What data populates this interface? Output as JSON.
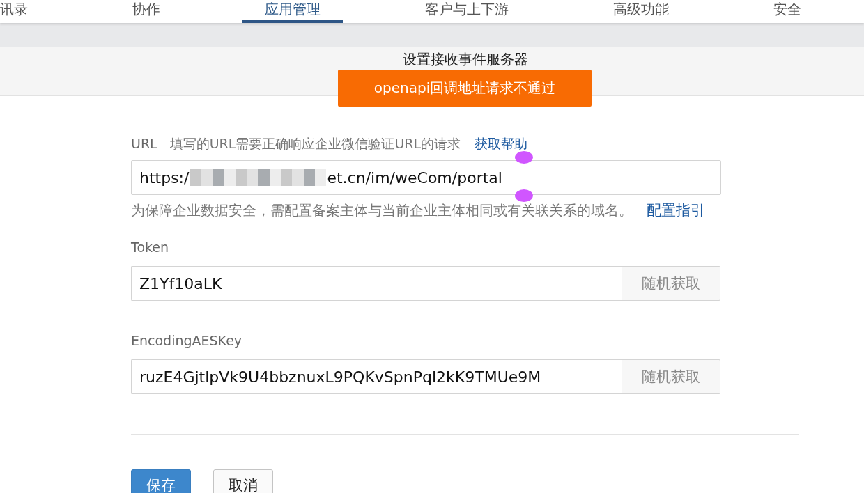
{
  "nav": {
    "tabs": [
      {
        "label": "讯录",
        "selected": false
      },
      {
        "label": "协作",
        "selected": false
      },
      {
        "label": "应用管理",
        "selected": true
      },
      {
        "label": "客户与上下游",
        "selected": false
      },
      {
        "label": "高级功能",
        "selected": false
      },
      {
        "label": "安全",
        "selected": false
      }
    ]
  },
  "panel": {
    "title": "设置接收事件服务器"
  },
  "toast": {
    "message": "openapi回调地址请求不通过"
  },
  "form": {
    "url": {
      "label": "URL",
      "hint": "填写的URL需要正确响应企业微信验证URL的请求",
      "help_link": "获取帮助",
      "value_start": "https:/",
      "value_end": "et.cn/im/weCom/portal",
      "note": "为保障企业数据安全，需配置备案主体与当前企业主体相同或有关联关系的域名。",
      "note_link": "配置指引"
    },
    "fields": [
      {
        "label": "Token",
        "value": "Z1Yf10aLK",
        "button": "随机获取"
      },
      {
        "label": "EncodingAESKey",
        "value": "ruzE4GjtlpVk9U4bbznuxL9PQKvSpnPql2kK9TMUe9M",
        "button": "随机获取"
      }
    ]
  },
  "buttons": [
    {
      "label": "保存",
      "kind": "primary"
    },
    {
      "label": "取消",
      "kind": "default"
    }
  ]
}
